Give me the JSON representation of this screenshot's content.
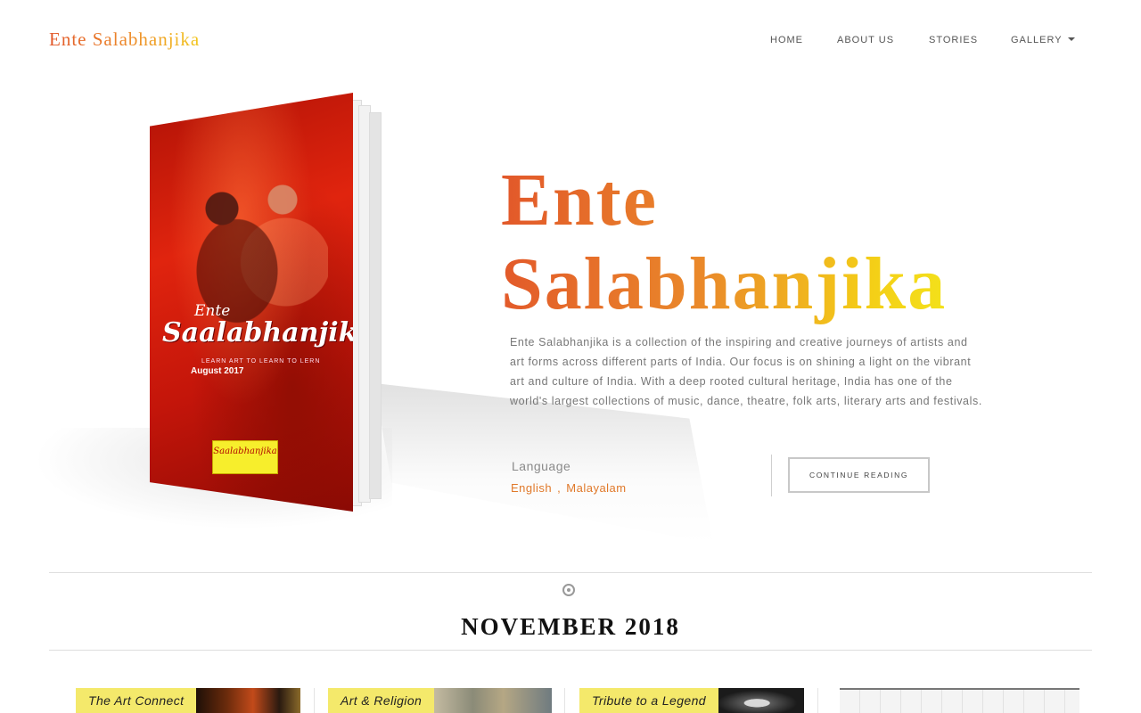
{
  "header": {
    "brand": "Ente Salabhanjika",
    "nav": [
      {
        "label": "HOME"
      },
      {
        "label": "ABOUT US"
      },
      {
        "label": "STORIES"
      },
      {
        "label": "GALLERY"
      }
    ]
  },
  "book_cover": {
    "ente": "Ente",
    "title": "Saalabhanjika",
    "tagline": "LEARN ART TO LEARN TO LERN",
    "date": "August 2017",
    "logo_text": "Saalabhanjika"
  },
  "hero": {
    "title_line1": "Ente",
    "title_line2": "Salabhanjika",
    "description": "Ente Salabhanjika is a collection of the inspiring and creative journeys of artists and art forms across different parts of India. Our focus is on shining a light on the vibrant art and culture of India. With a deep rooted cultural heritage, India has one of the world's largest collections of music, dance, theatre, folk arts, literary arts and festivals.",
    "language_label": "Language",
    "languages": [
      "English",
      "Malayalam"
    ],
    "language_separator": ",",
    "cta_label": "CONTINUE READING"
  },
  "section": {
    "title": "NOVEMBER 2018"
  },
  "cards": [
    {
      "label": "The Art Connect",
      "image": "lanterns-photo"
    },
    {
      "label": "Art & Religion",
      "image": "painting-photo"
    },
    {
      "label": "Tribute to a Legend",
      "image": "portrait-photo"
    },
    {
      "label": "",
      "image": "gallery-room-photo"
    }
  ],
  "colors": {
    "brand_gradient_start": "#e2572a",
    "brand_gradient_end": "#f3e61c",
    "accent_orange": "#e0792a",
    "card_label_bg": "#f4e96b",
    "cover_red": "#d8200c"
  }
}
